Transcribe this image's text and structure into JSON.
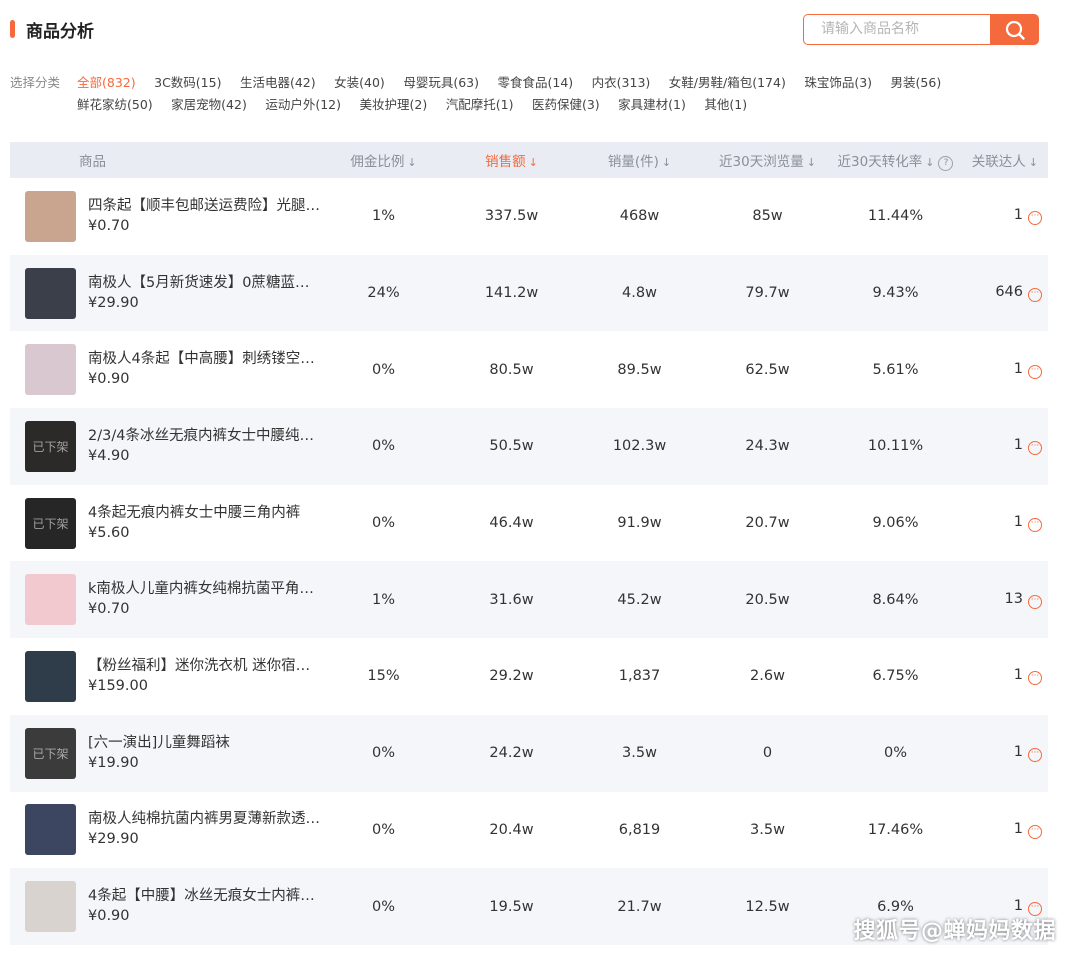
{
  "header": {
    "title": "商品分析"
  },
  "search": {
    "placeholder": "请输入商品名称",
    "icon": "search-icon"
  },
  "categories": {
    "label": "选择分类",
    "items": [
      "全部(832)",
      "3C数码(15)",
      "生活电器(42)",
      "女装(40)",
      "母婴玩具(63)",
      "零食食品(14)",
      "内衣(313)",
      "女鞋/男鞋/箱包(174)",
      "珠宝饰品(3)",
      "男装(56)",
      "鲜花家纺(50)",
      "家居宠物(42)",
      "运动户外(12)",
      "美妆护理(2)",
      "汽配摩托(1)",
      "医药保健(3)",
      "家具建材(1)",
      "其他(1)"
    ],
    "active_index": 0
  },
  "table": {
    "headers": {
      "product": "商品",
      "commission": "佣金比例",
      "sales_amount": "销售额",
      "sales_volume": "销量(件)",
      "views_30d": "近30天浏览量",
      "conversion_30d": "近30天转化率",
      "influencers": "关联达人"
    },
    "sort_arrow": "↓",
    "help_icon": "?",
    "more_icon": "···",
    "rows": [
      {
        "name": "四条起【顺丰包邮送运费险】光腿…",
        "price": "¥0.70",
        "commission": "1%",
        "sales": "337.5w",
        "volume": "468w",
        "views": "85w",
        "conversion": "11.44%",
        "influencers": "1",
        "thumb": "#c9a48e",
        "offshelf": ""
      },
      {
        "name": "南极人【5月新货速发】0蔗糖蓝山…",
        "price": "¥29.90",
        "commission": "24%",
        "sales": "141.2w",
        "volume": "4.8w",
        "views": "79.7w",
        "conversion": "9.43%",
        "influencers": "646",
        "thumb": "#3a3f4a",
        "offshelf": ""
      },
      {
        "name": "南极人4条起【中高腰】刺绣镂空…",
        "price": "¥0.90",
        "commission": "0%",
        "sales": "80.5w",
        "volume": "89.5w",
        "views": "62.5w",
        "conversion": "5.61%",
        "influencers": "1",
        "thumb": "#d9c8cf",
        "offshelf": ""
      },
      {
        "name": "2/3/4条冰丝无痕内裤女士中腰纯…",
        "price": "¥4.90",
        "commission": "0%",
        "sales": "50.5w",
        "volume": "102.3w",
        "views": "24.3w",
        "conversion": "10.11%",
        "influencers": "1",
        "thumb": "#2c2a28",
        "offshelf": "已下架"
      },
      {
        "name": "4条起无痕内裤女士中腰三角内裤",
        "price": "¥5.60",
        "commission": "0%",
        "sales": "46.4w",
        "volume": "91.9w",
        "views": "20.7w",
        "conversion": "9.06%",
        "influencers": "1",
        "thumb": "#262626",
        "offshelf": "已下架"
      },
      {
        "name": "k南极人儿童内裤女纯棉抗菌平角…",
        "price": "¥0.70",
        "commission": "1%",
        "sales": "31.6w",
        "volume": "45.2w",
        "views": "20.5w",
        "conversion": "8.64%",
        "influencers": "13",
        "thumb": "#f1c9cf",
        "offshelf": ""
      },
      {
        "name": "【粉丝福利】迷你洗衣机 迷你宿…",
        "price": "¥159.00",
        "commission": "15%",
        "sales": "29.2w",
        "volume": "1,837",
        "views": "2.6w",
        "conversion": "6.75%",
        "influencers": "1",
        "thumb": "#2f3c4a",
        "offshelf": ""
      },
      {
        "name": "[六一演出]儿童舞蹈袜",
        "price": "¥19.90",
        "commission": "0%",
        "sales": "24.2w",
        "volume": "3.5w",
        "views": "0",
        "conversion": "0%",
        "influencers": "1",
        "thumb": "#3b3b3b",
        "offshelf": "已下架"
      },
      {
        "name": "南极人纯棉抗菌内裤男夏薄新款透…",
        "price": "¥29.90",
        "commission": "0%",
        "sales": "20.4w",
        "volume": "6,819",
        "views": "3.5w",
        "conversion": "17.46%",
        "influencers": "1",
        "thumb": "#3c4660",
        "offshelf": ""
      },
      {
        "name": "4条起【中腰】冰丝无痕女士内裤…",
        "price": "¥0.90",
        "commission": "0%",
        "sales": "19.5w",
        "volume": "21.7w",
        "views": "12.5w",
        "conversion": "6.9%",
        "influencers": "1",
        "thumb": "#d8d3cf",
        "offshelf": ""
      }
    ]
  },
  "watermark": "搜狐号@蝉妈妈数据",
  "colors": {
    "accent": "#f56a3c",
    "header_bg": "#e9edf3",
    "stripe": "#f5f6fa"
  }
}
